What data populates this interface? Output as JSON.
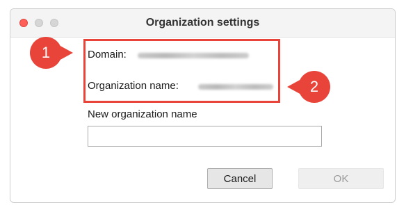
{
  "window": {
    "title": "Organization settings"
  },
  "info": {
    "domain_label": "Domain:",
    "org_name_label": "Organization name:"
  },
  "form": {
    "new_name_label": "New organization name",
    "new_name_value": ""
  },
  "buttons": {
    "cancel_label": "Cancel",
    "ok_label": "OK"
  },
  "annotations": {
    "callout_1": "1",
    "callout_2": "2",
    "color": "#e8443a"
  }
}
